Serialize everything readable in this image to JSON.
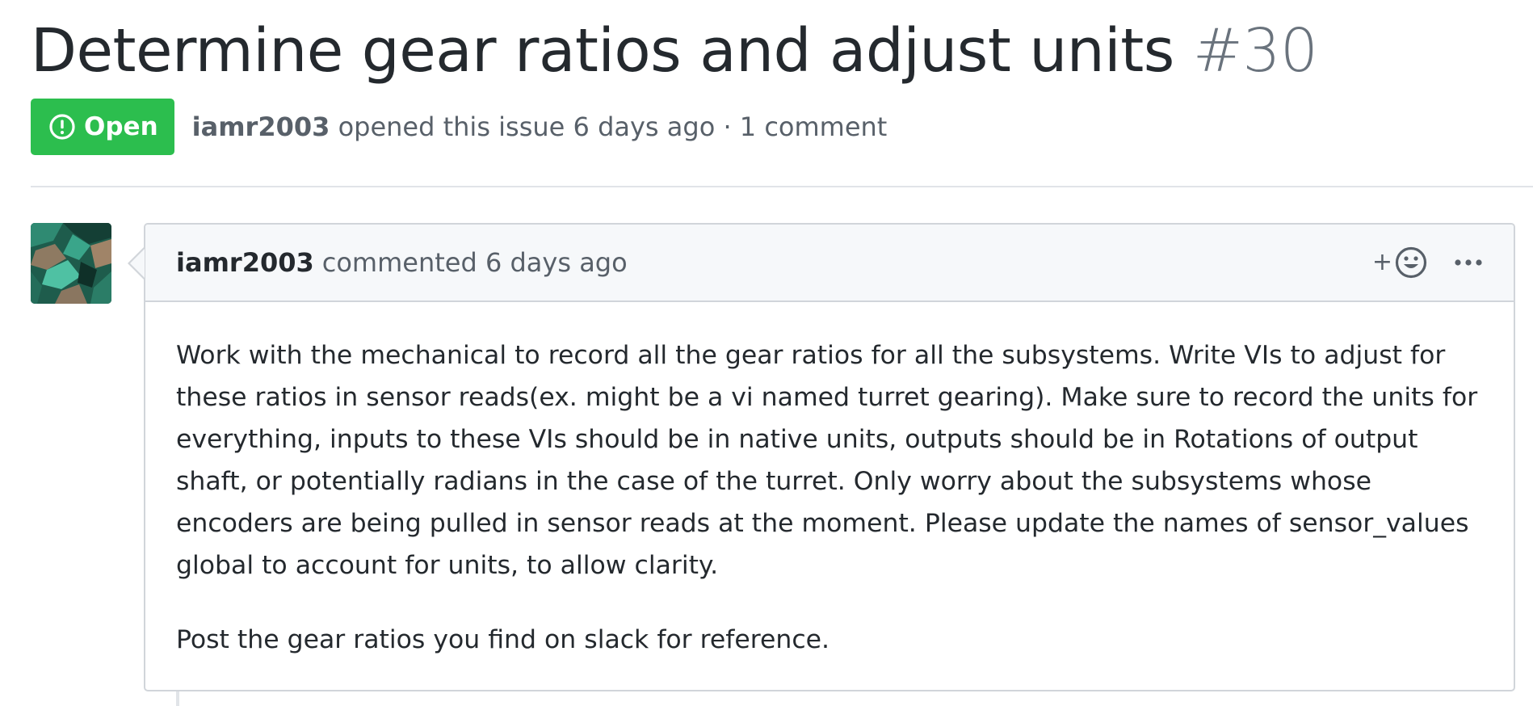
{
  "issue": {
    "title": "Determine gear ratios and adjust units",
    "number": "#30",
    "state": "Open",
    "state_icon": "issue-opened-icon",
    "state_color": "#2cbe4e",
    "author": "iamr2003",
    "meta_rest": "opened this issue 6 days ago · 1 comment"
  },
  "comment": {
    "author": "iamr2003",
    "time": "commented 6 days ago",
    "reaction_plus": "+",
    "reaction_icon": "smiley-icon",
    "more_icon": "kebab-horizontal-icon",
    "paragraphs": [
      "Work with the mechanical to record all the gear ratios for all the subsystems. Write VIs to adjust for these ratios in sensor reads(ex. might be a vi named turret gearing). Make sure to record the units for everything, inputs to these VIs should be in native units, outputs should be in Rotations of output shaft, or potentially radians in the case of the turret. Only worry about the subsystems whose encoders are being pulled in sensor reads at the moment. Please update the names of sensor_values global to account for units, to allow clarity.",
      "Post the gear ratios you find on slack for reference."
    ]
  },
  "colors": {
    "open_green": "#2cbe4e",
    "header_bg": "#f6f8fa",
    "border": "#d1d5da",
    "muted_text": "#586069"
  }
}
